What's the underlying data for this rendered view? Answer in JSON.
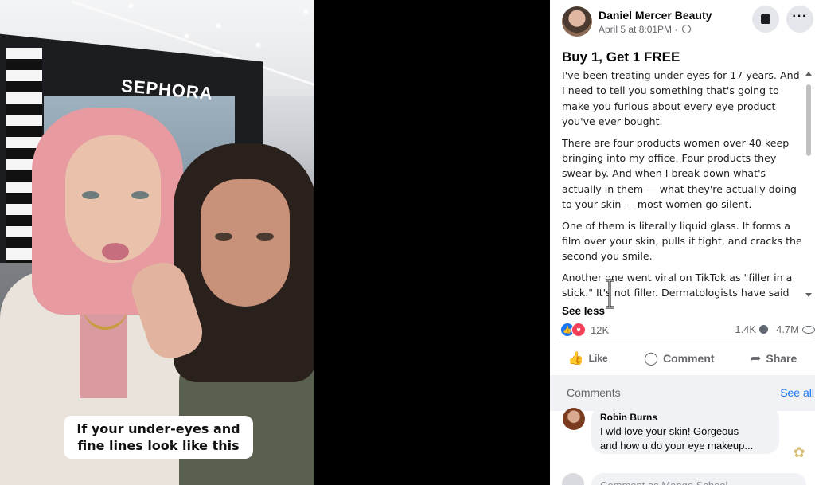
{
  "video": {
    "sign_text": "SEPHORA",
    "caption": "If your under-eyes and fine lines look like this"
  },
  "post": {
    "author": "Daniel Mercer Beauty",
    "timestamp": "April 5 at 8:01PM ·",
    "title": "Buy 1, Get 1 FREE",
    "paragraphs": [
      "I've been treating under eyes for 17 years. And I need to tell you something that's going to make you furious about every eye product you've ever bought.",
      "There are four products women over 40 keep bringing into my office. Four products they swear by. And when I break down what's actually in them — what they're actually doing to your skin — most women go silent.",
      "One of them is literally liquid glass. It forms a film over your skin, pulls it tight, and cracks the second you smile.",
      "Another one went viral on TikTok as \"filler in a stick.\" It's not filler. Dermatologists have said"
    ],
    "see_less": "See less",
    "reaction_count": "12K",
    "comment_count": "1.4K",
    "view_count": "4.7M"
  },
  "actions": {
    "like": "Like",
    "comment": "Comment",
    "share": "Share"
  },
  "comments": {
    "label": "Comments",
    "see_all": "See all",
    "items": [
      {
        "name": "Robin Burns",
        "text_line1": "I wld love your skin! Gorgeous",
        "text_line2": "and how u do your eye makeup..."
      }
    ],
    "write_placeholder": "Comment as Mango School"
  },
  "icons": {
    "like_reaction": "thumbs-up-icon",
    "love_reaction": "heart-icon",
    "bookmark": "bookmark-icon",
    "more": "more-options-icon"
  },
  "colors": {
    "accent": "#1877f2",
    "love": "#f33e58",
    "secondary_text": "#65676b"
  }
}
